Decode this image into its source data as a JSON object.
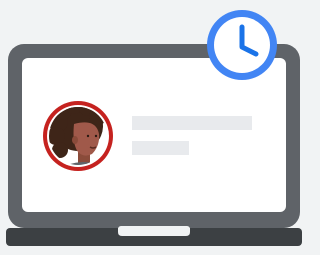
{
  "illustration": {
    "subject": "laptop-with-profile-and-clock",
    "profile_card": {
      "text_lines": 2
    },
    "badge_icon": "clock-icon"
  },
  "colors": {
    "background": "#f1f3f4",
    "laptop_frame": "#5f6368",
    "laptop_base": "#3c4043",
    "screen": "#ffffff",
    "avatar_ring": "#c5221f",
    "text_placeholder": "#e8eaed",
    "clock_blue": "#4285f4",
    "clock_face": "#ffffff",
    "clock_hands": "#1a73e8"
  }
}
